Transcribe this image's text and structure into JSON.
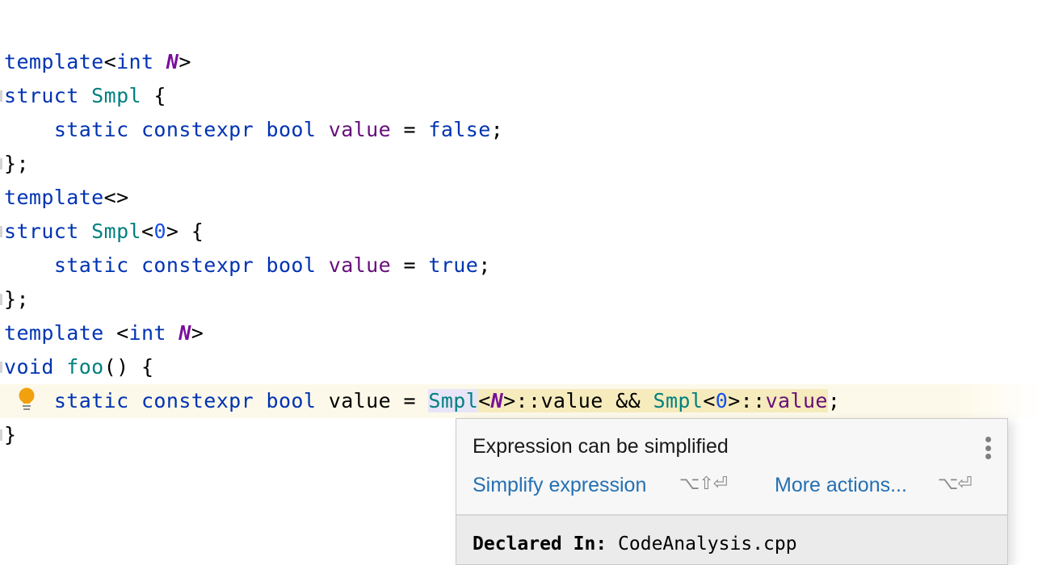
{
  "editor": {
    "language": "C++",
    "lines": [
      {
        "tokens": [
          [
            "kw",
            "template"
          ],
          [
            "punct",
            "<"
          ],
          [
            "kw",
            "int"
          ],
          [
            "punct",
            " "
          ],
          [
            "tparam",
            "N"
          ],
          [
            "punct",
            ">"
          ]
        ]
      },
      {
        "tokens": [
          [
            "kw",
            "struct"
          ],
          [
            "punct",
            " "
          ],
          [
            "tp",
            "Smpl"
          ],
          [
            "punct",
            " {"
          ]
        ]
      },
      {
        "tokens": [
          [
            "punct",
            "    "
          ],
          [
            "kw",
            "static"
          ],
          [
            "punct",
            " "
          ],
          [
            "kw",
            "constexpr"
          ],
          [
            "punct",
            " "
          ],
          [
            "kw",
            "bool"
          ],
          [
            "punct",
            " "
          ],
          [
            "field",
            "value"
          ],
          [
            "punct",
            " = "
          ],
          [
            "kw",
            "false"
          ],
          [
            "punct",
            ";"
          ]
        ]
      },
      {
        "tokens": [
          [
            "punct",
            "};"
          ]
        ]
      },
      {
        "tokens": [
          [
            "kw",
            "template"
          ],
          [
            "punct",
            "<>"
          ]
        ]
      },
      {
        "tokens": [
          [
            "kw",
            "struct"
          ],
          [
            "punct",
            " "
          ],
          [
            "tp",
            "Smpl"
          ],
          [
            "punct",
            "<"
          ],
          [
            "num",
            "0"
          ],
          [
            "punct",
            "> {"
          ]
        ]
      },
      {
        "tokens": [
          [
            "punct",
            "    "
          ],
          [
            "kw",
            "static"
          ],
          [
            "punct",
            " "
          ],
          [
            "kw",
            "constexpr"
          ],
          [
            "punct",
            " "
          ],
          [
            "kw",
            "bool"
          ],
          [
            "punct",
            " "
          ],
          [
            "field",
            "value"
          ],
          [
            "punct",
            " = "
          ],
          [
            "kw",
            "true"
          ],
          [
            "punct",
            ";"
          ]
        ]
      },
      {
        "tokens": [
          [
            "punct",
            "};"
          ]
        ]
      },
      {
        "tokens": [
          [
            "kw",
            "template"
          ],
          [
            "punct",
            " <"
          ],
          [
            "kw",
            "int"
          ],
          [
            "punct",
            " "
          ],
          [
            "tparam",
            "N"
          ],
          [
            "punct",
            ">"
          ]
        ]
      },
      {
        "tokens": [
          [
            "kw",
            "void"
          ],
          [
            "punct",
            " "
          ],
          [
            "tp",
            "foo"
          ],
          [
            "punct",
            "() {"
          ]
        ]
      },
      {
        "tokens": [
          [
            "punct",
            "    "
          ],
          [
            "kw",
            "static"
          ],
          [
            "punct",
            " "
          ],
          [
            "kw",
            "constexpr"
          ],
          [
            "punct",
            " "
          ],
          [
            "kw",
            "bool"
          ],
          [
            "punct",
            " value = "
          ],
          [
            "tp hl-ref",
            "Smpl"
          ],
          [
            "punct hl-warn",
            "<"
          ],
          [
            "tparam hl-warn",
            "N"
          ],
          [
            "punct hl-warn",
            ">::value && "
          ],
          [
            "tp hl-warn",
            "Smpl"
          ],
          [
            "punct hl-warn",
            "<"
          ],
          [
            "num hl-warn",
            "0"
          ],
          [
            "punct hl-warn",
            ">::"
          ],
          [
            "field hl-warn",
            "value"
          ],
          [
            "punct",
            ";"
          ]
        ],
        "current": true,
        "intention": "lightbulb-icon"
      },
      {
        "tokens": [
          [
            "punct",
            "}"
          ]
        ]
      }
    ],
    "fold_marker_lines": [
      1,
      3,
      5,
      7,
      9,
      11
    ]
  },
  "popup": {
    "title": "Expression can be simplified",
    "primary_action": {
      "label": "Simplify expression",
      "shortcut": "⌥⇧⏎"
    },
    "secondary_action": {
      "label": "More actions...",
      "shortcut": "⌥⏎"
    },
    "declared_label": "Declared In:",
    "declared_value": "CodeAnalysis.cpp"
  },
  "colors": {
    "keyword": "#0033b3",
    "type": "#00807f",
    "template_param": "#7a0e9c",
    "field": "#660e7a",
    "number": "#1750eb",
    "link": "#2470b3",
    "current_line": "#fdf9ea",
    "warning_highlight": "#f6ebbc",
    "reference_highlight": "#e7e5f7",
    "lightbulb": "#f1a10d"
  }
}
